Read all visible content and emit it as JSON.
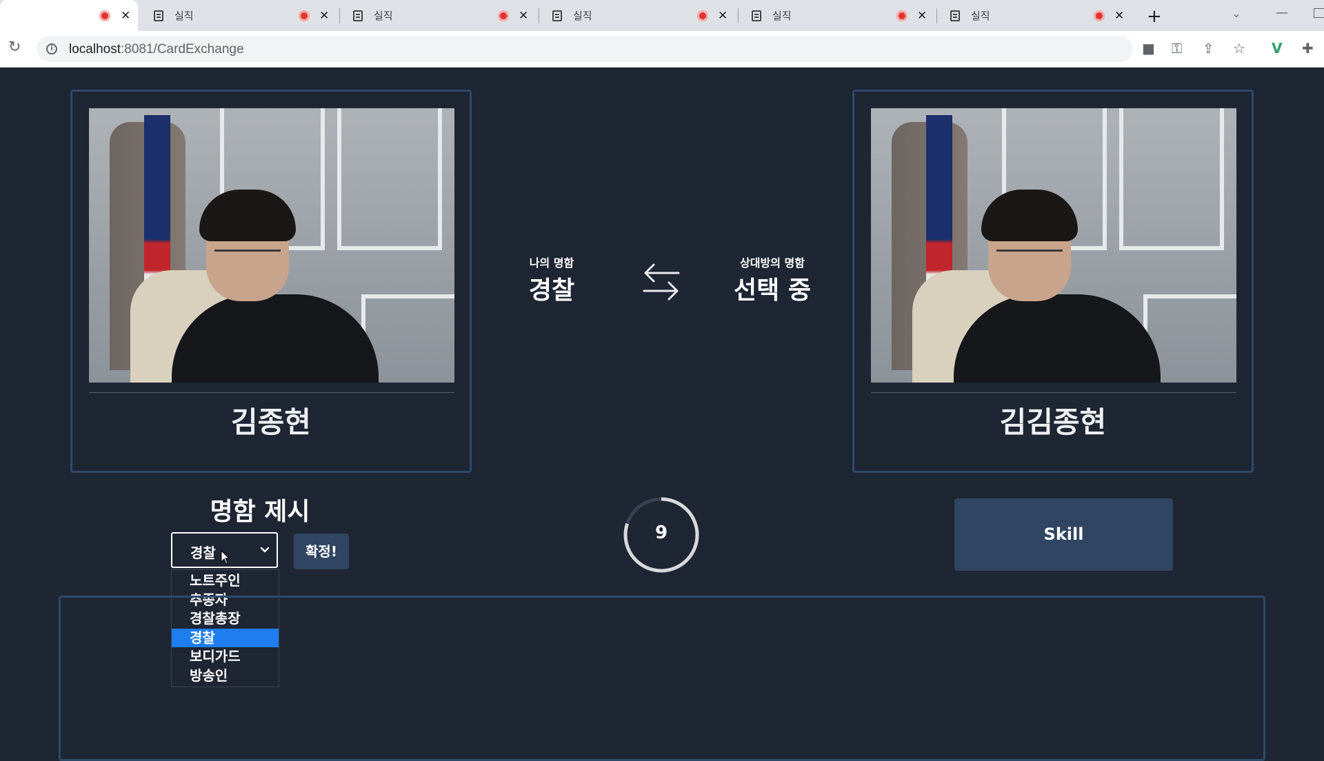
{
  "browser": {
    "tabs": [
      {
        "title": "",
        "active": true
      },
      {
        "title": "실직",
        "active": false
      },
      {
        "title": "실직",
        "active": false
      },
      {
        "title": "실직",
        "active": false
      },
      {
        "title": "실직",
        "active": false
      },
      {
        "title": "실직",
        "active": false
      }
    ],
    "url_host": "localhost",
    "url_port_path": ":8081/CardExchange"
  },
  "players": {
    "me": {
      "name": "김종현"
    },
    "opponent": {
      "name": "김김종현"
    }
  },
  "exchange": {
    "my_card_label": "나의 명함",
    "my_card_value": "경찰",
    "opponent_card_label": "상대방의 명함",
    "opponent_card_value": "선택 중"
  },
  "offer": {
    "title": "명함 제시",
    "selected": "경찰",
    "options": [
      "노트주인",
      "추종자",
      "경찰총장",
      "경찰",
      "보디가드",
      "방송인"
    ],
    "highlighted_index": 3,
    "confirm_label": "확정!"
  },
  "timer": {
    "value": "9",
    "remaining_fraction": 0.8
  },
  "skill": {
    "label": "Skill"
  },
  "colors": {
    "background": "#1e2533",
    "panel_border": "#2d4a6b",
    "button": "#2f4561",
    "highlight": "#1e7ef0",
    "recording": "#e0352f"
  }
}
